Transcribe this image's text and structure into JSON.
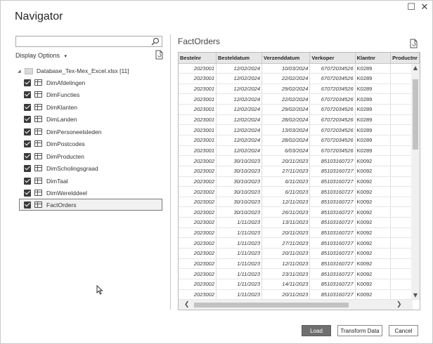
{
  "window": {
    "title": "Navigator",
    "controls": {
      "maximize": "☐",
      "close": "✕"
    }
  },
  "left_panel": {
    "search": {
      "value": "",
      "placeholder": ""
    },
    "display_options": "Display Options",
    "display_options_chevron": "▾",
    "root": {
      "arrow": "◢",
      "label": "Database_Tex-Mex_Excel.xlsx [11]"
    },
    "items": [
      {
        "label": "DimAfdelingen",
        "checked": true
      },
      {
        "label": "DimFuncties",
        "checked": true
      },
      {
        "label": "DimKlanten",
        "checked": true
      },
      {
        "label": "DimLanden",
        "checked": true
      },
      {
        "label": "DimPersoneelsleden",
        "checked": true
      },
      {
        "label": "DimPostcodes",
        "checked": true
      },
      {
        "label": "DimProducten",
        "checked": true
      },
      {
        "label": "DimScholingsgraad",
        "checked": true
      },
      {
        "label": "DimTaal",
        "checked": true
      },
      {
        "label": "DimWerelddeel",
        "checked": true
      },
      {
        "label": "FactOrders",
        "checked": true,
        "selected": true
      }
    ]
  },
  "preview": {
    "title": "FactOrders",
    "columns": [
      "Bestelnr",
      "Besteldatum",
      "Verzenddatum",
      "Verkoper",
      "Klantnr",
      "Productnr"
    ],
    "rows": [
      [
        "2023001",
        "12/02/2024",
        "10/03/2024",
        "67072034526",
        "K0289"
      ],
      [
        "2023001",
        "12/02/2024",
        "22/02/2024",
        "67072034526",
        "K0289"
      ],
      [
        "2023001",
        "12/02/2024",
        "29/02/2024",
        "67072034526",
        "K0289"
      ],
      [
        "2023001",
        "12/02/2024",
        "22/02/2024",
        "67072034526",
        "K0289"
      ],
      [
        "2023001",
        "12/02/2024",
        "29/02/2024",
        "67072034526",
        "K0289"
      ],
      [
        "2023001",
        "12/02/2024",
        "28/02/2024",
        "67072034526",
        "K0289"
      ],
      [
        "2023001",
        "12/02/2024",
        "13/03/2024",
        "67072034526",
        "K0289"
      ],
      [
        "2023001",
        "12/02/2024",
        "28/02/2024",
        "67072034526",
        "K0289"
      ],
      [
        "2023001",
        "12/02/2024",
        "6/03/2024",
        "67072034526",
        "K0289"
      ],
      [
        "2023002",
        "30/10/2023",
        "20/11/2023",
        "85103160727",
        "K0092"
      ],
      [
        "2023002",
        "30/10/2023",
        "27/11/2023",
        "85103160727",
        "K0092"
      ],
      [
        "2023002",
        "30/10/2023",
        "6/11/2023",
        "85103160727",
        "K0092"
      ],
      [
        "2023002",
        "30/10/2023",
        "6/11/2023",
        "85103160727",
        "K0092"
      ],
      [
        "2023002",
        "30/10/2023",
        "12/11/2023",
        "85103160727",
        "K0092"
      ],
      [
        "2023002",
        "30/10/2023",
        "26/11/2023",
        "85103160727",
        "K0092"
      ],
      [
        "2023002",
        "1/11/2023",
        "13/11/2023",
        "85103160727",
        "K0092"
      ],
      [
        "2023002",
        "1/11/2023",
        "20/11/2023",
        "85103160727",
        "K0092"
      ],
      [
        "2023002",
        "1/11/2023",
        "27/11/2023",
        "85103160727",
        "K0092"
      ],
      [
        "2023002",
        "1/11/2023",
        "20/11/2023",
        "85103160727",
        "K0092"
      ],
      [
        "2023002",
        "1/11/2023",
        "12/11/2023",
        "85103160727",
        "K0092"
      ],
      [
        "2023002",
        "1/11/2023",
        "23/11/2023",
        "85103160727",
        "K0092"
      ],
      [
        "2023002",
        "1/11/2023",
        "14/11/2023",
        "85103160727",
        "K0092"
      ],
      [
        "2023002",
        "1/11/2023",
        "20/11/2023",
        "85103160727",
        "K0092"
      ]
    ],
    "scroll": {
      "up": "▲",
      "down": "▼",
      "left": "❮",
      "right": "❯"
    }
  },
  "footer": {
    "load": "Load",
    "transform": "Transform Data",
    "cancel": "Cancel"
  }
}
